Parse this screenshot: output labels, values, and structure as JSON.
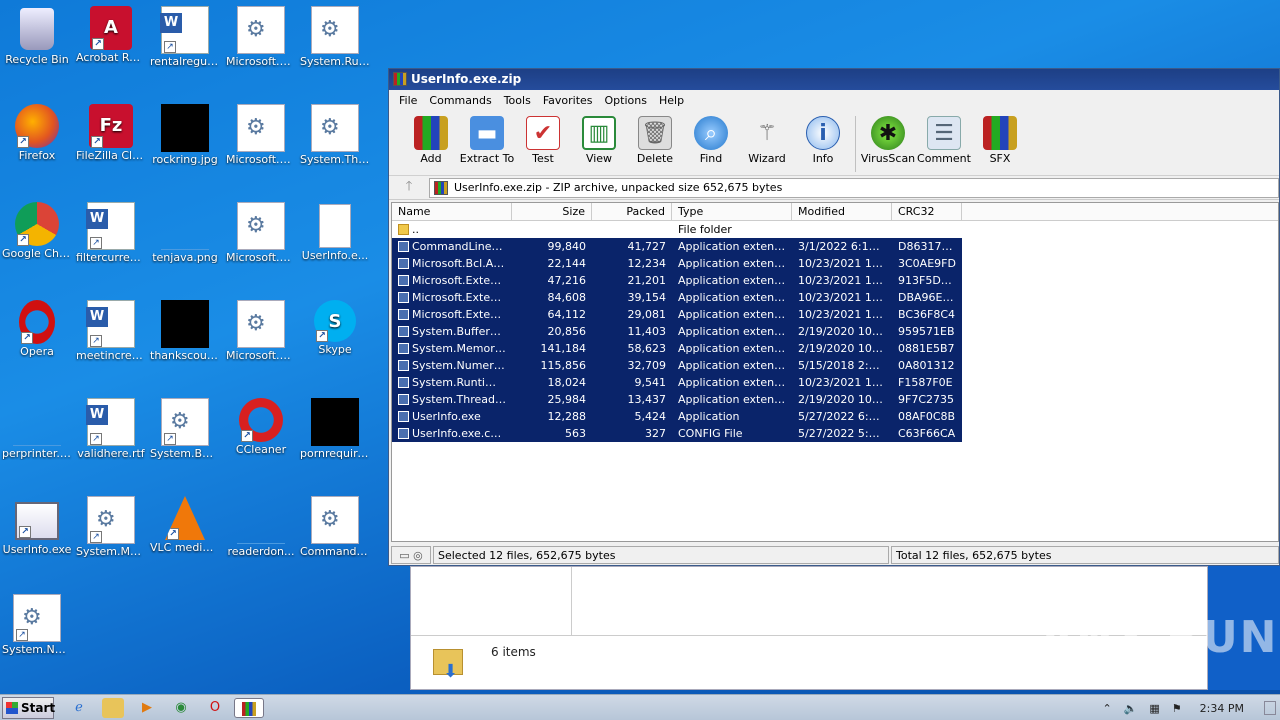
{
  "desktop": {
    "icons": [
      {
        "label": "Recycle Bin",
        "icon": "recycle-bin-icon"
      },
      {
        "label": "Acrobat Reader DC",
        "icon": "acrobat-icon"
      },
      {
        "label": "rentalregula...",
        "icon": "word-doc-icon"
      },
      {
        "label": "Microsoft.B...",
        "icon": "dll-icon"
      },
      {
        "label": "System.Run...",
        "icon": "dll-icon"
      },
      {
        "label": "Firefox",
        "icon": "firefox-icon"
      },
      {
        "label": "FileZilla Client",
        "icon": "filezilla-icon"
      },
      {
        "label": "rockring.jpg",
        "icon": "image-icon"
      },
      {
        "label": "Microsoft.E...",
        "icon": "dll-icon"
      },
      {
        "label": "System.Thr...",
        "icon": "dll-icon"
      },
      {
        "label": "Google Chrome",
        "icon": "chrome-icon"
      },
      {
        "label": "filtercurrent...",
        "icon": "word-doc-icon"
      },
      {
        "label": "tenjava.png",
        "icon": "image-icon"
      },
      {
        "label": "Microsoft.E...",
        "icon": "dll-icon"
      },
      {
        "label": "UserInfo.e...",
        "icon": "file-icon"
      },
      {
        "label": "Opera",
        "icon": "opera-icon"
      },
      {
        "label": "meetincrea...",
        "icon": "word-doc-icon"
      },
      {
        "label": "thankscour...",
        "icon": "image-icon"
      },
      {
        "label": "Microsoft.E...",
        "icon": "dll-icon"
      },
      {
        "label": "Skype",
        "icon": "skype-icon"
      },
      {
        "label": "perprinter.png",
        "icon": "image-icon"
      },
      {
        "label": "validhere.rtf",
        "icon": "word-doc-icon"
      },
      {
        "label": "System.Buf...",
        "icon": "dll-icon"
      },
      {
        "label": "CCleaner",
        "icon": "ccleaner-icon"
      },
      {
        "label": "pornrequire...",
        "icon": "image-icon"
      },
      {
        "label": "UserInfo.exe",
        "icon": "exe-icon"
      },
      {
        "label": "System.Me...",
        "icon": "dll-icon"
      },
      {
        "label": "VLC media player",
        "icon": "vlc-icon"
      },
      {
        "label": "readerdon...",
        "icon": "image-icon"
      },
      {
        "label": "CommandLi...",
        "icon": "dll-icon"
      },
      {
        "label": "System.Nu...",
        "icon": "dll-icon"
      }
    ]
  },
  "winrar": {
    "title": "UserInfo.exe.zip",
    "menu": [
      "File",
      "Commands",
      "Tools",
      "Favorites",
      "Options",
      "Help"
    ],
    "toolbar": [
      "Add",
      "Extract To",
      "Test",
      "View",
      "Delete",
      "Find",
      "Wizard",
      "Info",
      "VirusScan",
      "Comment",
      "SFX"
    ],
    "address": "UserInfo.exe.zip - ZIP archive, unpacked size 652,675 bytes",
    "columns": [
      "Name",
      "Size",
      "Packed",
      "Type",
      "Modified",
      "CRC32"
    ],
    "files": [
      {
        "name": "..",
        "size": "",
        "packed": "",
        "type": "File folder",
        "modified": "",
        "crc": ""
      },
      {
        "name": "CommandLinePar...",
        "size": "99,840",
        "packed": "41,727",
        "type": "Application extension",
        "modified": "3/1/2022 6:18 PM",
        "crc": "D86317D3"
      },
      {
        "name": "Microsoft.Bcl.Asy...",
        "size": "22,144",
        "packed": "12,234",
        "type": "Application extension",
        "modified": "10/23/2021 12:...",
        "crc": "3C0AE9FD"
      },
      {
        "name": "Microsoft.Extensi...",
        "size": "47,216",
        "packed": "21,201",
        "type": "Application extension",
        "modified": "10/23/2021 12:...",
        "crc": "913F5DD1"
      },
      {
        "name": "Microsoft.Extensi...",
        "size": "84,608",
        "packed": "39,154",
        "type": "Application extension",
        "modified": "10/23/2021 12:...",
        "crc": "DBA96E47"
      },
      {
        "name": "Microsoft.Extensi...",
        "size": "64,112",
        "packed": "29,081",
        "type": "Application extension",
        "modified": "10/23/2021 12:...",
        "crc": "BC36F8C4"
      },
      {
        "name": "System.Buffers.dll",
        "size": "20,856",
        "packed": "11,403",
        "type": "Application extension",
        "modified": "2/19/2020 10:0...",
        "crc": "959571EB"
      },
      {
        "name": "System.Memory.dll",
        "size": "141,184",
        "packed": "58,623",
        "type": "Application extension",
        "modified": "2/19/2020 10:0...",
        "crc": "0881E5B7"
      },
      {
        "name": "System.Numerics....",
        "size": "115,856",
        "packed": "32,709",
        "type": "Application extension",
        "modified": "5/15/2018 2:29...",
        "crc": "0A801312"
      },
      {
        "name": "System.Runtime....",
        "size": "18,024",
        "packed": "9,541",
        "type": "Application extension",
        "modified": "10/23/2021 12:...",
        "crc": "F1587F0E"
      },
      {
        "name": "System.Threadin...",
        "size": "25,984",
        "packed": "13,437",
        "type": "Application extension",
        "modified": "2/19/2020 10:0...",
        "crc": "9F7C2735"
      },
      {
        "name": "UserInfo.exe",
        "size": "12,288",
        "packed": "5,424",
        "type": "Application",
        "modified": "5/27/2022 6:51...",
        "crc": "08AF0C8B"
      },
      {
        "name": "UserInfo.exe.co...",
        "size": "563",
        "packed": "327",
        "type": "CONFIG File",
        "modified": "5/27/2022 5:59...",
        "crc": "C63F66CA"
      }
    ],
    "status_left": "Selected 12 files, 652,675 bytes",
    "status_right": "Total 12 files, 652,675 bytes"
  },
  "explorer": {
    "items_text": "6 items"
  },
  "watermark": "ANY RUN",
  "taskbar": {
    "start": "Start",
    "clock": "2:34 PM"
  }
}
